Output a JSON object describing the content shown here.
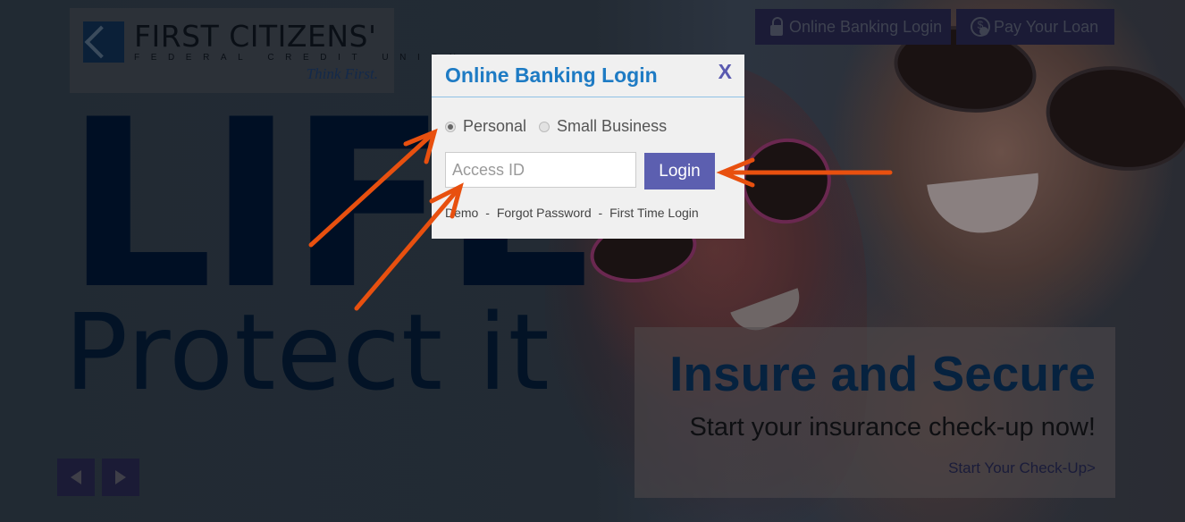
{
  "header": {
    "logo": {
      "name": "FIRST CITIZENS'",
      "subtitle": "FEDERAL CREDIT UNION",
      "tagline": "Think First."
    },
    "buttons": [
      {
        "label": "Online Banking Login",
        "icon": "lock-icon"
      },
      {
        "label": "Pay Your Loan",
        "icon": "loan-payment-icon"
      }
    ]
  },
  "hero": {
    "headline": "LIFE",
    "subheadline": "Protect it",
    "slider": {
      "prev_icon": "chevron-left-icon",
      "next_icon": "chevron-right-icon"
    }
  },
  "promo": {
    "title": "Insure and Secure",
    "subtitle": "Start your insurance check-up now!",
    "link": "Start Your Check-Up>"
  },
  "modal": {
    "title": "Online Banking Login",
    "close_label": "X",
    "account_types": [
      {
        "label": "Personal",
        "checked": true
      },
      {
        "label": "Small Business",
        "checked": false
      }
    ],
    "access_id": {
      "value": "",
      "placeholder": "Access ID"
    },
    "login_label": "Login",
    "links": [
      "Demo",
      "Forgot Password",
      "First Time Login"
    ],
    "link_separator": "-"
  },
  "colors": {
    "modal_title": "#1e7bc4",
    "login_button": "#5c5fb0",
    "annotation_arrow": "#e8500f"
  }
}
